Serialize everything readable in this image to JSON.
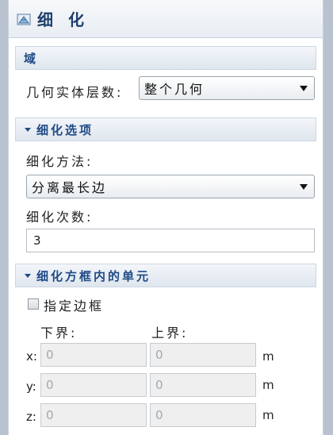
{
  "header": {
    "title": "细 化"
  },
  "domain_section": {
    "title": "域",
    "level_label": "几何实体层数:",
    "level_value": "整个几何"
  },
  "refine_options": {
    "title": "细化选项",
    "method_label": "细化方法:",
    "method_value": "分离最长边",
    "count_label": "细化次数:",
    "count_value": "3"
  },
  "box_section": {
    "title": "细化方框内的单元",
    "checkbox_label": "指定边框",
    "lower_label": "下界:",
    "upper_label": "上界:",
    "rows": [
      {
        "axis": "x:",
        "lower": "0",
        "upper": "0",
        "unit": "m"
      },
      {
        "axis": "y:",
        "lower": "0",
        "upper": "0",
        "unit": "m"
      },
      {
        "axis": "z:",
        "lower": "0",
        "upper": "0",
        "unit": "m"
      }
    ]
  }
}
